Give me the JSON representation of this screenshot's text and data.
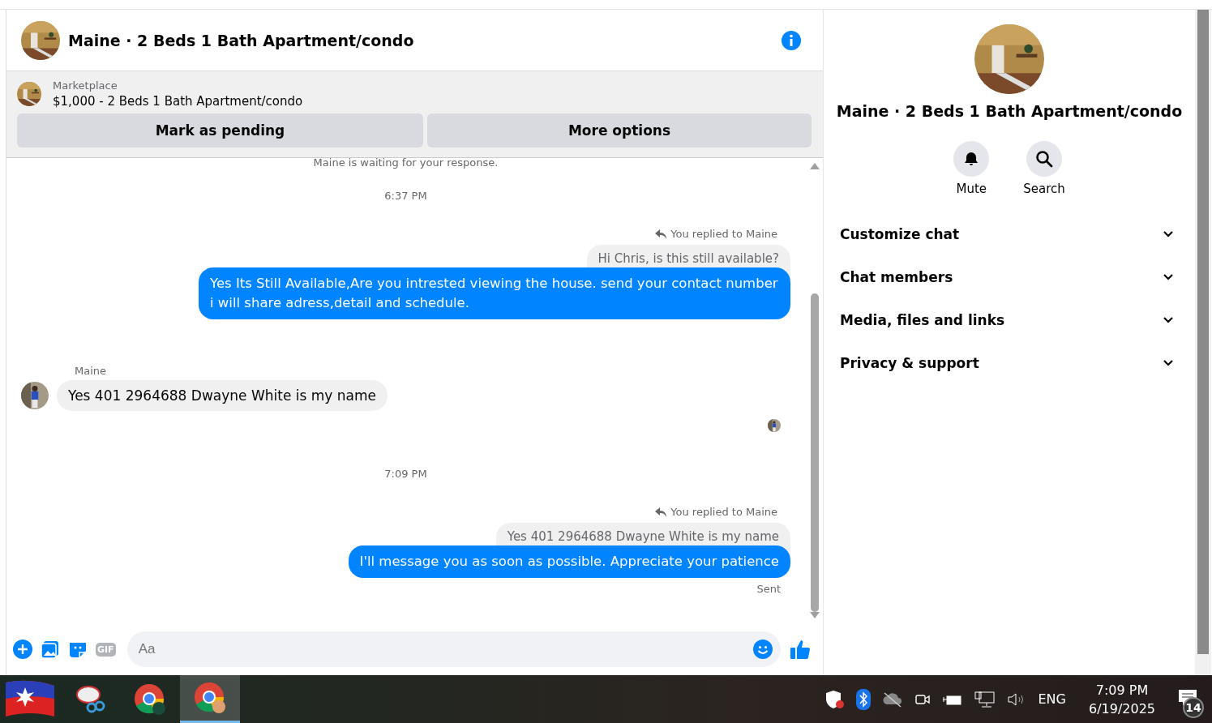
{
  "chat_header": {
    "title": "Maine · 2 Beds 1 Bath Apartment/condo"
  },
  "listing": {
    "source": "Marketplace",
    "title": "$1,000 - 2 Beds 1 Bath Apartment/condo",
    "buttons": [
      "Mark as pending",
      "More options"
    ]
  },
  "messages": [
    {
      "kind": "status",
      "text": "Maine is waiting for your response."
    },
    {
      "kind": "time",
      "text": "6:37 PM"
    },
    {
      "kind": "reply_label",
      "text": "You replied to Maine"
    },
    {
      "kind": "quoted",
      "text": "Hi Chris, is this still available?"
    },
    {
      "kind": "outgoing",
      "text": "Yes Its Still Available,Are you intrested viewing the house. send your contact number i will share adress,detail and schedule."
    },
    {
      "kind": "sender",
      "text": "Maine"
    },
    {
      "kind": "incoming",
      "text": "Yes 401 2964688 Dwayne White is my name"
    },
    {
      "kind": "seen"
    },
    {
      "kind": "time",
      "text": "7:09 PM"
    },
    {
      "kind": "reply_label",
      "text": "You replied to Maine"
    },
    {
      "kind": "quoted",
      "text": "Yes 401 2964688 Dwayne White is my name"
    },
    {
      "kind": "outgoing",
      "text": "I'll message you as soon as possible. Appreciate your patience"
    },
    {
      "kind": "sent",
      "text": "Sent"
    }
  ],
  "composer": {
    "placeholder": "Aa",
    "gif_label": "GIF"
  },
  "info_panel": {
    "title": "Maine · 2 Beds 1 Bath Apartment/condo",
    "actions": [
      {
        "kind": "mute",
        "label": "Mute"
      },
      {
        "kind": "search",
        "label": "Search"
      }
    ],
    "sections": [
      {
        "label": "Customize chat",
        "expanded": false
      },
      {
        "label": "Chat members",
        "expanded": false
      },
      {
        "label": "Media, files and links",
        "expanded": false
      },
      {
        "label": "Privacy & support",
        "expanded": false
      }
    ]
  },
  "taskbar": {
    "apps": [
      {
        "kind": "flag",
        "active": false
      },
      {
        "kind": "snip",
        "active": false
      },
      {
        "kind": "chrome",
        "active": false
      },
      {
        "kind": "chrome-profile",
        "active": true
      }
    ],
    "language": "ENG",
    "time": "7:09 PM",
    "date": "6/19/2025",
    "notifications": "14"
  }
}
